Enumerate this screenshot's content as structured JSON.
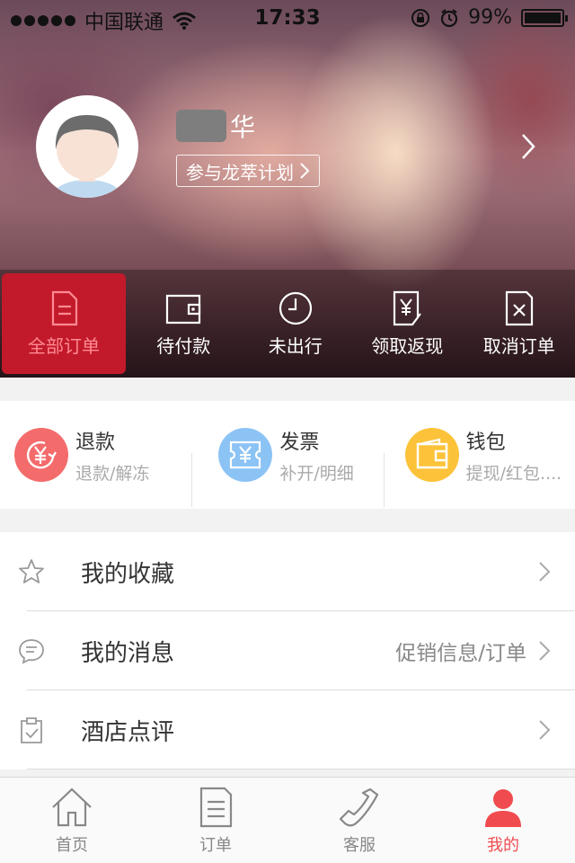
{
  "status_bar": {
    "carrier": "中国联通",
    "time": "17:33",
    "battery": "99%",
    "battery_level": 0.99
  },
  "profile": {
    "name_visible": "华",
    "join_link": "参与龙萃计划"
  },
  "order_tabs": [
    {
      "label": "全部订单",
      "icon": "document-icon",
      "active": true
    },
    {
      "label": "待付款",
      "icon": "wallet-icon",
      "active": false
    },
    {
      "label": "未出行",
      "icon": "clock-icon",
      "active": false
    },
    {
      "label": "领取返现",
      "icon": "cashback-icon",
      "active": false
    },
    {
      "label": "取消订单",
      "icon": "cancel-document-icon",
      "active": false
    }
  ],
  "services": [
    {
      "title": "退款",
      "subtitle": "退款/解冻",
      "icon": "refund-icon",
      "color": "#f46b6b"
    },
    {
      "title": "发票",
      "subtitle": "补开/明细",
      "icon": "invoice-icon",
      "color": "#8cc3f5"
    },
    {
      "title": "钱包",
      "subtitle": "提现/红包....",
      "icon": "wallet-icon",
      "color": "#fcc33a"
    }
  ],
  "menu": [
    {
      "label": "我的收藏",
      "extra": "",
      "icon": "star-icon"
    },
    {
      "label": "我的消息",
      "extra": "促销信息/订单",
      "icon": "message-icon"
    },
    {
      "label": "酒店点评",
      "extra": "",
      "icon": "clipboard-check-icon"
    }
  ],
  "tab_bar": [
    {
      "label": "首页",
      "icon": "home-icon",
      "active": false
    },
    {
      "label": "订单",
      "icon": "document-icon",
      "active": false
    },
    {
      "label": "客服",
      "icon": "phone-icon",
      "active": false
    },
    {
      "label": "我的",
      "icon": "user-icon",
      "active": true
    }
  ],
  "colors": {
    "accent": "#f04b4f",
    "active_tab_bg": "#c21a2a"
  }
}
